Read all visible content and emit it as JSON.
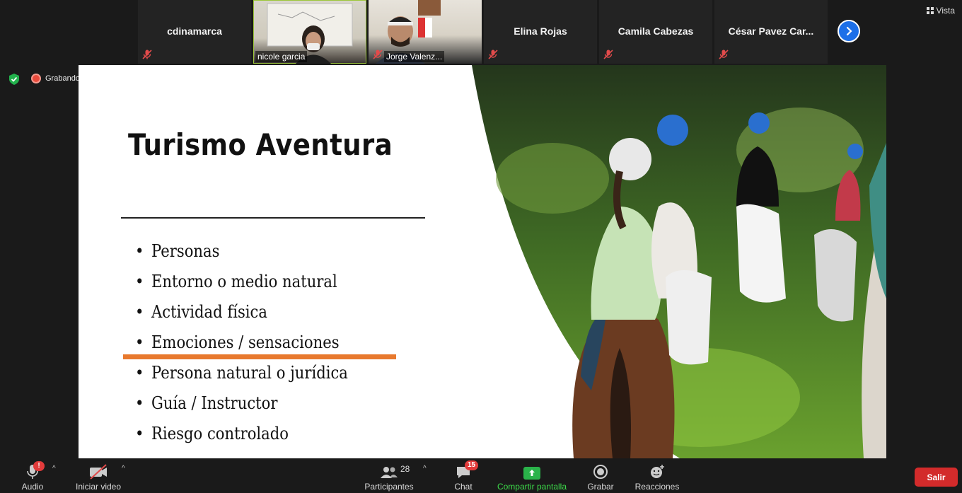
{
  "participants": [
    {
      "name": "cdinamarca",
      "video": false,
      "muted": true
    },
    {
      "name": "nicole garcia",
      "video": true,
      "muted": false
    },
    {
      "name": "Jorge Valenz...",
      "video": true,
      "muted": true
    },
    {
      "name": "Elina Rojas",
      "video": false,
      "muted": true
    },
    {
      "name": "Camila Cabezas",
      "video": false,
      "muted": true
    },
    {
      "name": "César Pavez Car...",
      "video": false,
      "muted": true
    }
  ],
  "view_label": "Vista",
  "recording_label": "Grabando",
  "slide": {
    "title": "Turismo Aventura",
    "bullets": [
      "Personas",
      "Entorno o medio natural",
      "Actividad física",
      "Emociones / sensaciones",
      "Persona natural o jurídica",
      "Guía / Instructor",
      "Riesgo controlado"
    ]
  },
  "toolbar": {
    "audio_label": "Audio",
    "audio_badge": "!",
    "video_label": "Iniciar video",
    "participants_label": "Participantes",
    "participants_count": "28",
    "chat_label": "Chat",
    "chat_badge": "15",
    "share_label": "Compartir pantalla",
    "record_label": "Grabar",
    "reactions_label": "Reacciones",
    "leave_label": "Salir"
  },
  "colors": {
    "accent_blue": "#1c6fe8",
    "share_green": "#3ddc4a",
    "leave_red": "#d32b2b",
    "underline_orange": "#e8792e",
    "active_speaker": "#9dc73b"
  }
}
